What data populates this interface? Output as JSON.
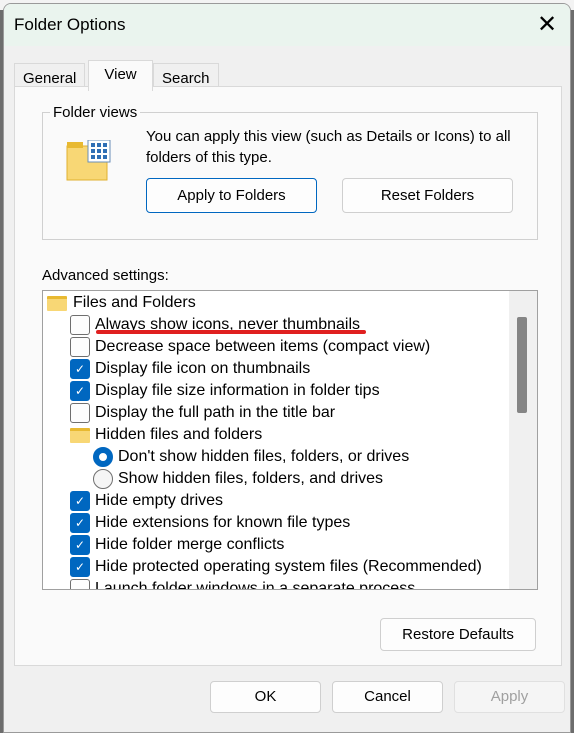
{
  "window": {
    "title": "Folder Options"
  },
  "tabs": [
    {
      "label": "General"
    },
    {
      "label": "View",
      "active": true
    },
    {
      "label": "Search"
    }
  ],
  "folder_views": {
    "label": "Folder views",
    "description": "You can apply this view (such as Details or Icons) to all folders of this type.",
    "apply_label": "Apply to Folders",
    "reset_label": "Reset Folders"
  },
  "advanced": {
    "label": "Advanced settings:",
    "items": [
      {
        "type": "folder",
        "label": "Files and Folders"
      },
      {
        "type": "checkbox",
        "label": "Always show icons, never thumbnails",
        "checked": false,
        "annotated": true
      },
      {
        "type": "checkbox",
        "label": "Decrease space between items (compact view)",
        "checked": false
      },
      {
        "type": "checkbox",
        "label": "Display file icon on thumbnails",
        "checked": true
      },
      {
        "type": "checkbox",
        "label": "Display file size information in folder tips",
        "checked": true
      },
      {
        "type": "checkbox",
        "label": "Display the full path in the title bar",
        "checked": false
      },
      {
        "type": "folder",
        "label": "Hidden files and folders"
      },
      {
        "type": "radio",
        "label": "Don't show hidden files, folders, or drives",
        "checked": true
      },
      {
        "type": "radio",
        "label": "Show hidden files, folders, and drives",
        "checked": false
      },
      {
        "type": "checkbox",
        "label": "Hide empty drives",
        "checked": true
      },
      {
        "type": "checkbox",
        "label": "Hide extensions for known file types",
        "checked": true
      },
      {
        "type": "checkbox",
        "label": "Hide folder merge conflicts",
        "checked": true
      },
      {
        "type": "checkbox",
        "label": "Hide protected operating system files (Recommended)",
        "checked": true
      },
      {
        "type": "checkbox",
        "label": "Launch folder windows in a separate process",
        "checked": false
      }
    ],
    "restore_label": "Restore Defaults"
  },
  "footer": {
    "ok": "OK",
    "cancel": "Cancel",
    "apply": "Apply"
  },
  "colors": {
    "accent": "#0067c0",
    "annotation": "#e02020",
    "titlebar": "#eaf4ee"
  }
}
